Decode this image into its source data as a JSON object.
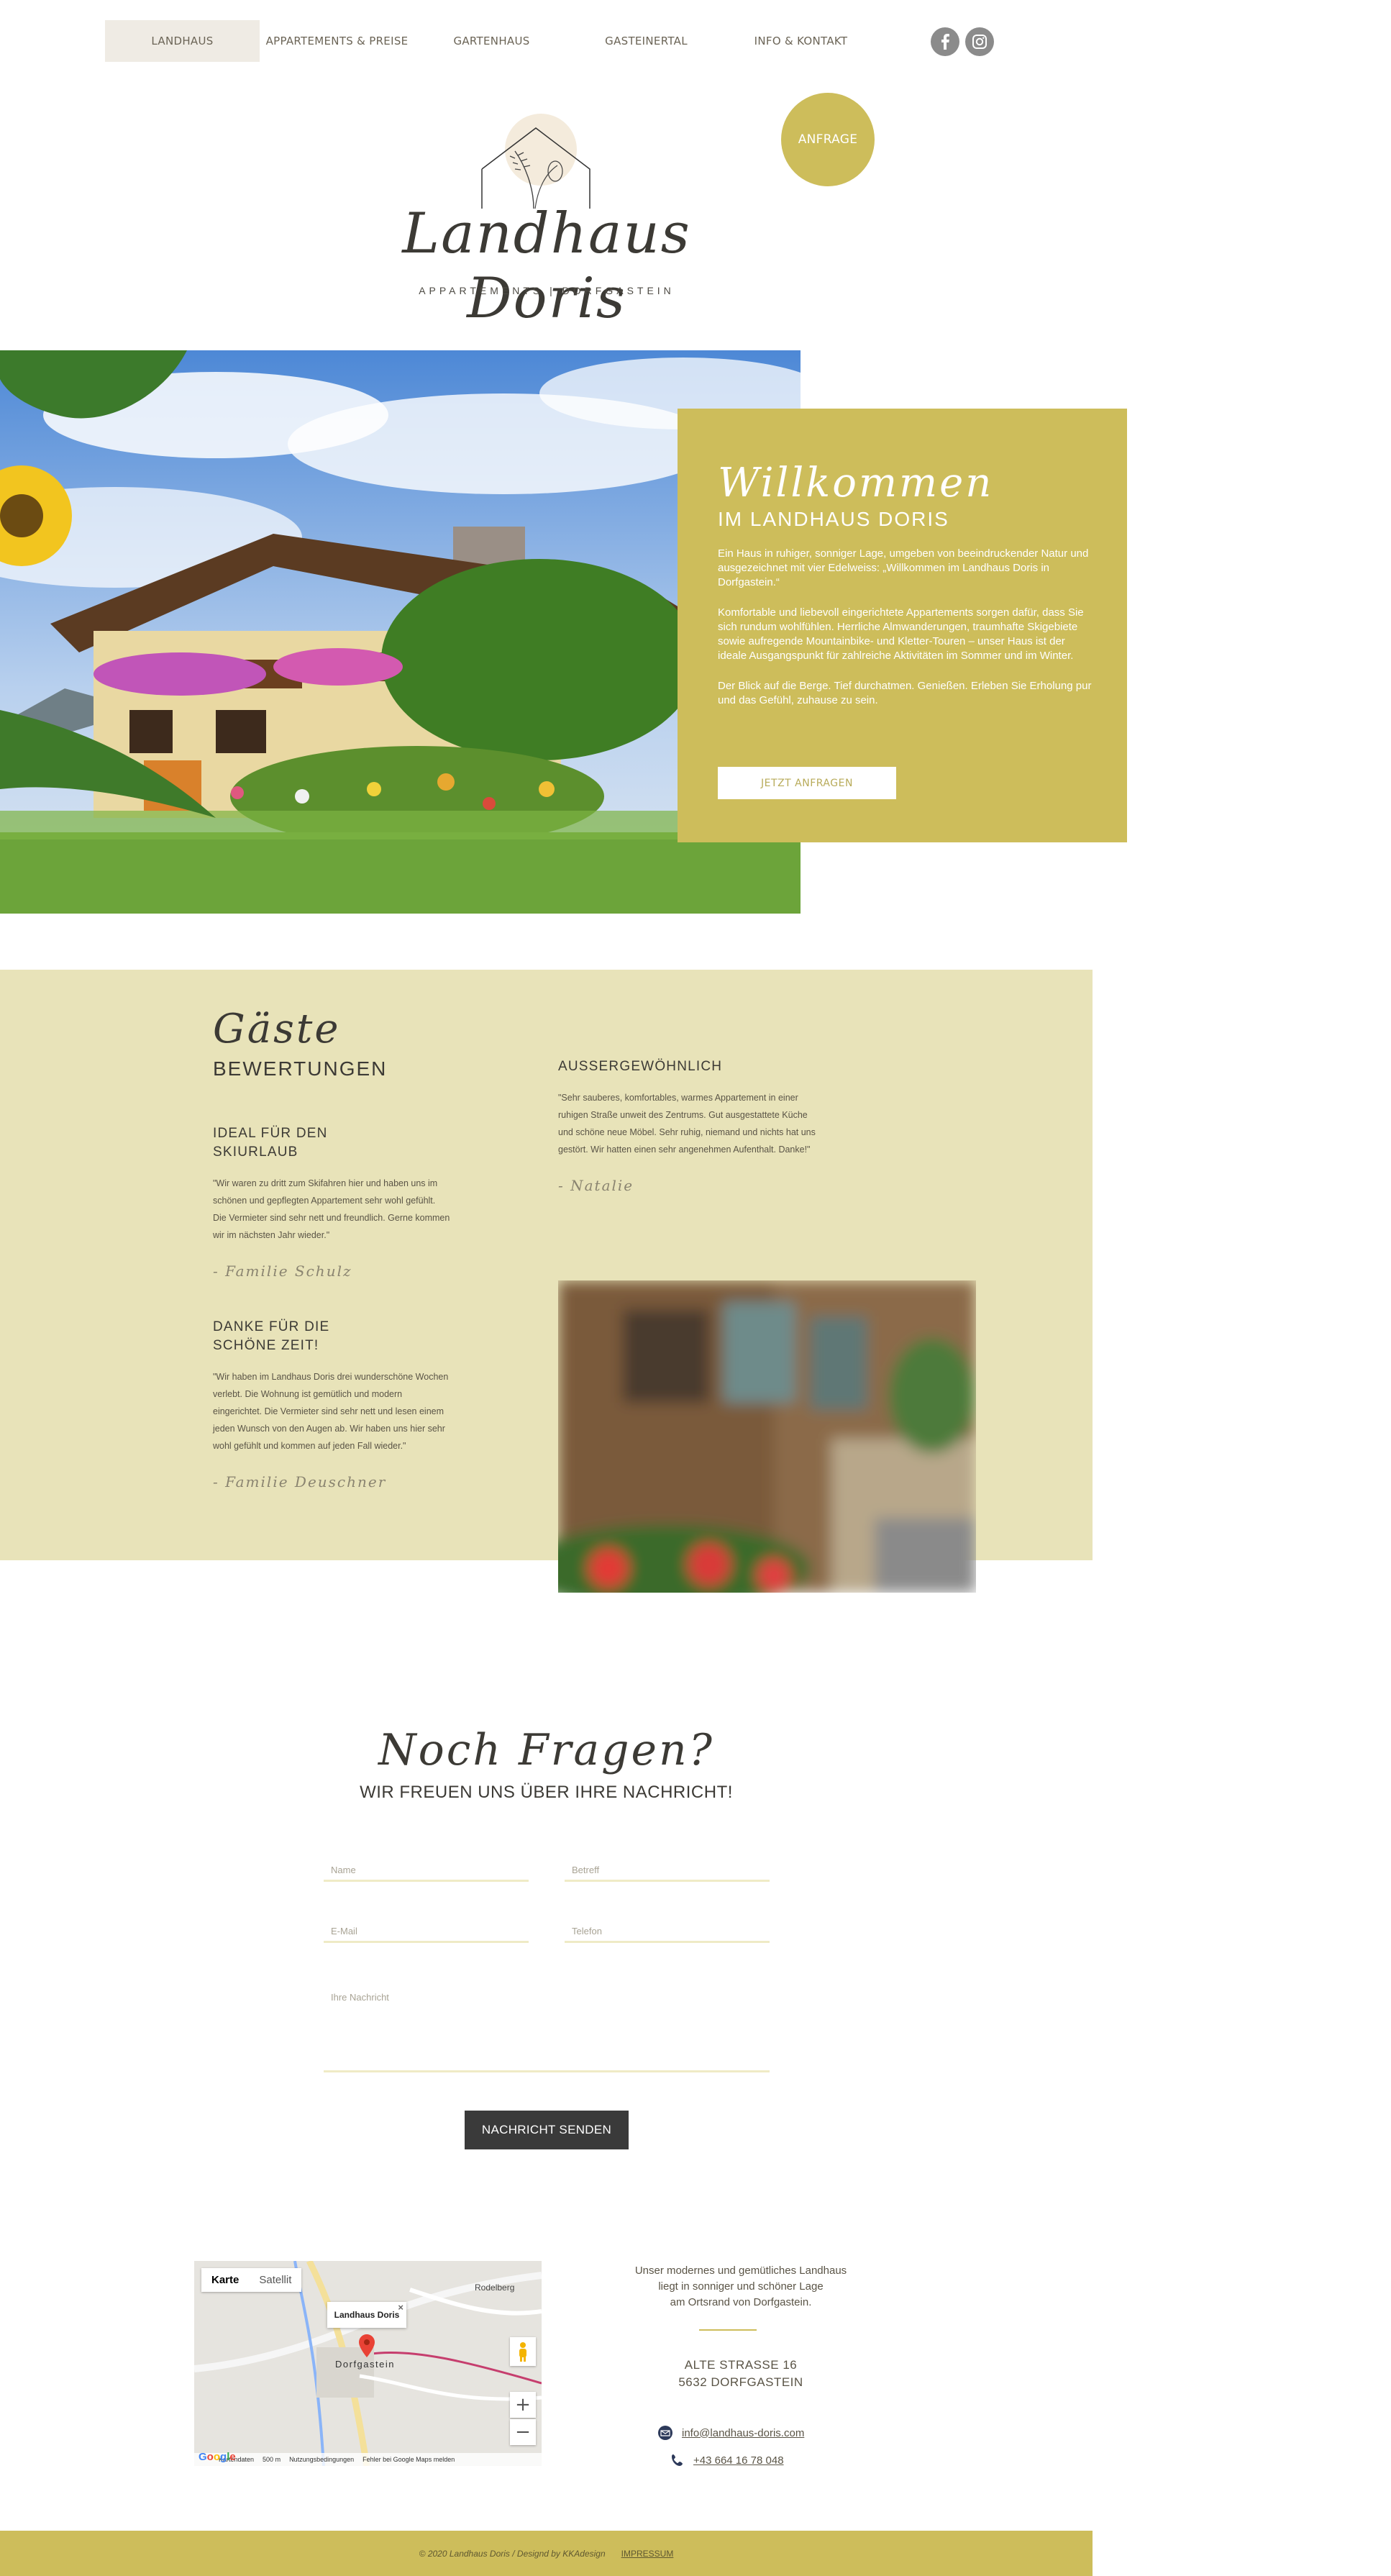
{
  "nav": {
    "items": [
      {
        "label": "LANDHAUS"
      },
      {
        "label": "APPARTEMENTS & PREISE"
      },
      {
        "label": "GARTENHAUS"
      },
      {
        "label": "GASTEINERTAL"
      },
      {
        "label": "INFO & KONTAKT"
      }
    ],
    "active_index": 0
  },
  "social": {
    "facebook_icon": "facebook-icon",
    "instagram_icon": "instagram-icon"
  },
  "anfrage_button": "ANFRAGE",
  "logo": {
    "script": "Landhaus Doris",
    "subtitle": "APPARTEMENTS | DORFGASTEIN"
  },
  "welcome": {
    "script": "Willkommen",
    "subtitle": "IM LANDHAUS DORIS",
    "p1": "Ein Haus in ruhiger, sonniger Lage, umgeben von beeindruckender Natur und ausgezeichnet mit vier Edelweiss: „Willkommen im Landhaus Doris in Dorfgastein.“",
    "p2": "Komfortable und liebevoll eingerichtete Appartements sorgen dafür, dass Sie sich rundum wohlfühlen. Herrliche Almwanderungen, traumhafte Skigebiete sowie aufregende Mountainbike- und Kletter-Touren – unser Haus ist der ideale Ausgangspunkt für zahlreiche Aktivitäten im Sommer und im Winter.",
    "p3": "Der Blick auf die Berge. Tief durchatmen. Genießen. Erleben Sie Erholung pur und das Gefühl, zuhause zu sein.",
    "button": "JETZT ANFRAGEN"
  },
  "reviews": {
    "script": "Gäste",
    "title": "BEWERTUNGEN",
    "items": [
      {
        "heading": "IDEAL FÜR DEN SKIURLAUB",
        "text": "\"Wir waren zu dritt zum Skifahren hier und haben uns im schönen und gepflegten Appartement sehr wohl gefühlt. Die Vermieter sind sehr nett und freundlich. Gerne kommen wir im nächsten Jahr wieder.\"",
        "sign": "- Familie Schulz"
      },
      {
        "heading": "DANKE FÜR DIE SCHÖNE ZEIT!",
        "text": "\"Wir haben im Landhaus Doris drei wunderschöne Wochen verlebt. Die Wohnung ist gemütlich und modern eingerichtet. Die Vermieter sind sehr nett und lesen einem jeden Wunsch von den Augen ab. Wir haben uns hier sehr wohl gefühlt und kommen auf jeden Fall wieder.\"",
        "sign": "- Familie Deuschner"
      },
      {
        "heading": "AUSSERGEWÖHNLICH",
        "text": "\"Sehr sauberes, komfortables, warmes Appartement in einer ruhigen Straße unweit des Zentrums. Gut ausgestattete Küche und schöne neue Möbel. Sehr ruhig, niemand und nichts hat uns gestört. Wir hatten einen sehr angenehmen Aufenthalt. Danke!\"",
        "sign": "- Natalie"
      }
    ]
  },
  "contact": {
    "script": "Noch Fragen?",
    "subtitle": "WIR FREUEN UNS ÜBER IHRE NACHRICHT!",
    "name_placeholder": "Name",
    "subject_placeholder": "Betreff",
    "email_placeholder": "E-Mail",
    "phone_placeholder": "Telefon",
    "message_placeholder": "Ihre Nachricht",
    "send_button": "NACHRICHT SENDEN"
  },
  "map": {
    "tab_map": "Karte",
    "tab_satellite": "Satellit",
    "info_title": "Landhaus Doris",
    "place_label": "Dorfgastein",
    "town_label": "Rodelberg",
    "footer_items": [
      "Kartendaten",
      "500 m",
      "Nutzungsbedingungen",
      "Fehler bei Google Maps melden"
    ],
    "zoom_in": "+",
    "zoom_out": "−"
  },
  "address": {
    "intro_1": "Unser modernes und gemütliches Landhaus",
    "intro_2": "liegt in sonniger und schöner Lage",
    "intro_3": "am Ortsrand von Dorfgastein.",
    "street": "ALTE STRASSE 16",
    "city": "5632 DORFGASTEIN",
    "email": "info@landhaus-doris.com",
    "phone": "+43 664 16 78 048"
  },
  "footer": {
    "copyright": "© 2020 Landhaus Doris / Designd by KKAdesign",
    "impressum": "IMPRESSUM"
  },
  "colors": {
    "accent": "#cdbd5b",
    "light_accent": "#e8e3b9",
    "dark": "#3a3a3a"
  }
}
